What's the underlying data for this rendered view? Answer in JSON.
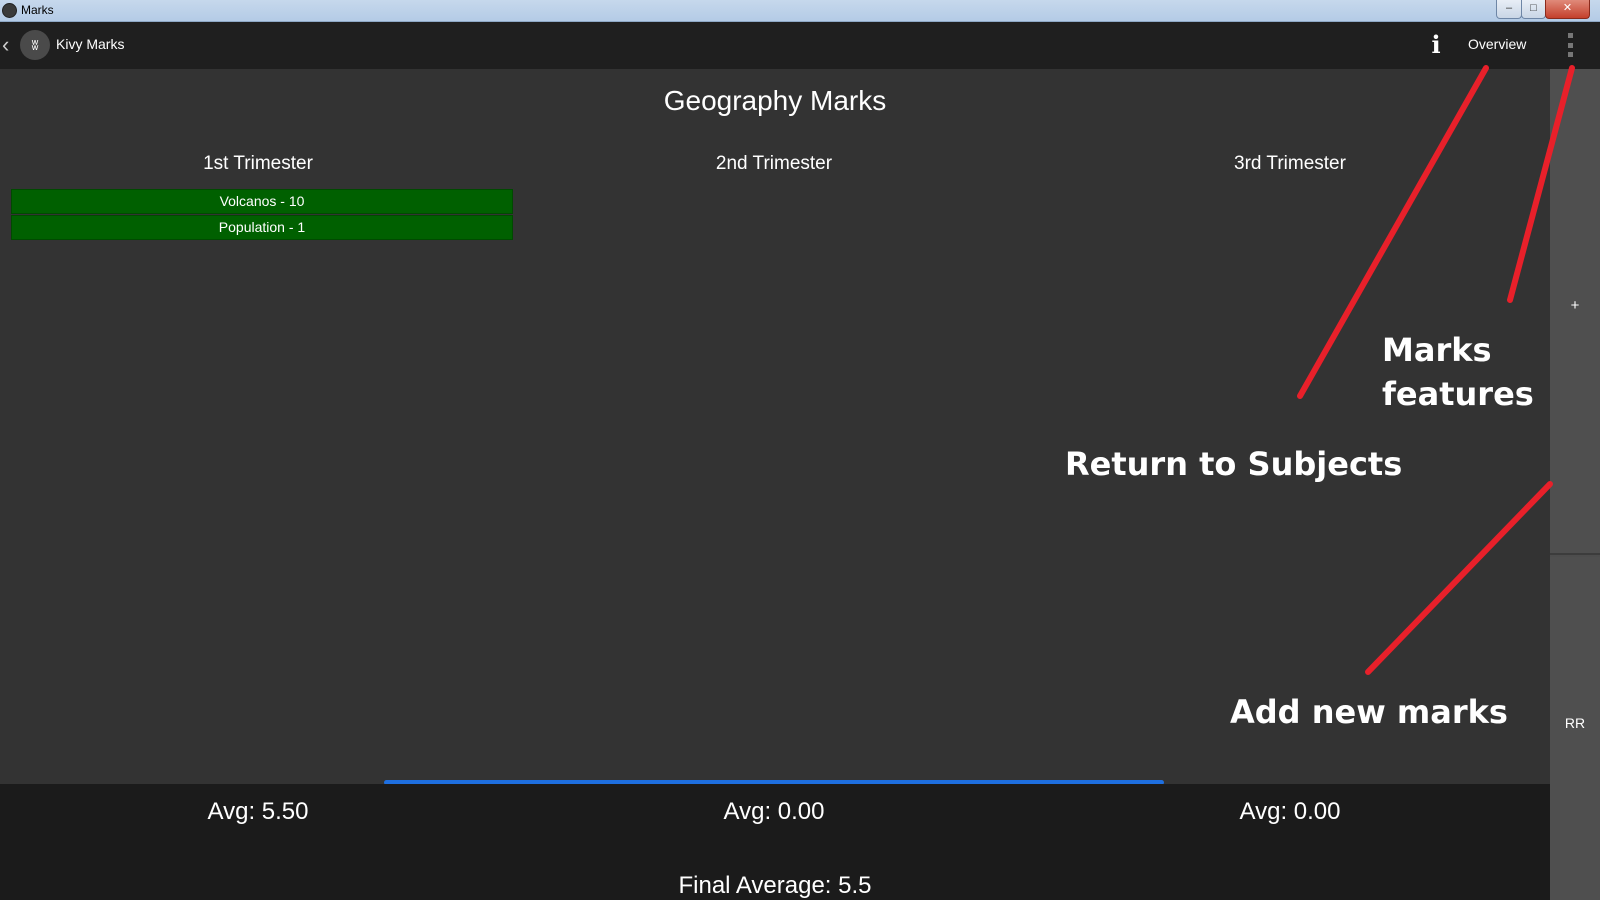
{
  "window": {
    "title": "Marks",
    "controls": {
      "minimize": "–",
      "maximize": "□",
      "close": "✕"
    }
  },
  "actionbar": {
    "back_icon": "‹",
    "logo_icon": "kivy-logo",
    "logo_glyph": "ʬ",
    "app_name": "Kivy Marks",
    "info_label": "i",
    "overview_label": "Overview"
  },
  "main": {
    "title": "Geography Marks",
    "trimesters": [
      {
        "label": "1st Trimester",
        "marks": [
          "Volcanos - 10",
          "Population - 1"
        ],
        "avg": "Avg: 5.50"
      },
      {
        "label": "2nd Trimester",
        "marks": [],
        "avg": "Avg: 0.00"
      },
      {
        "label": "3rd Trimester",
        "marks": [],
        "avg": "Avg: 0.00"
      }
    ],
    "final_average": "Final Average: 5.5",
    "mark_color": "#006000"
  },
  "side_panel": {
    "add_label": "+",
    "rr_label": "RR"
  },
  "annotations": {
    "return_to_subjects": "Return to Subjects",
    "marks_features_line1": "Marks",
    "marks_features_line2": "features",
    "add_new_marks": "Add new marks",
    "color": "#e8202a"
  },
  "colors": {
    "background": "#333333",
    "actionbar": "#1f1f1f",
    "footer": "#1b1b1b",
    "scroll_indicator": "#1e6fe0"
  }
}
